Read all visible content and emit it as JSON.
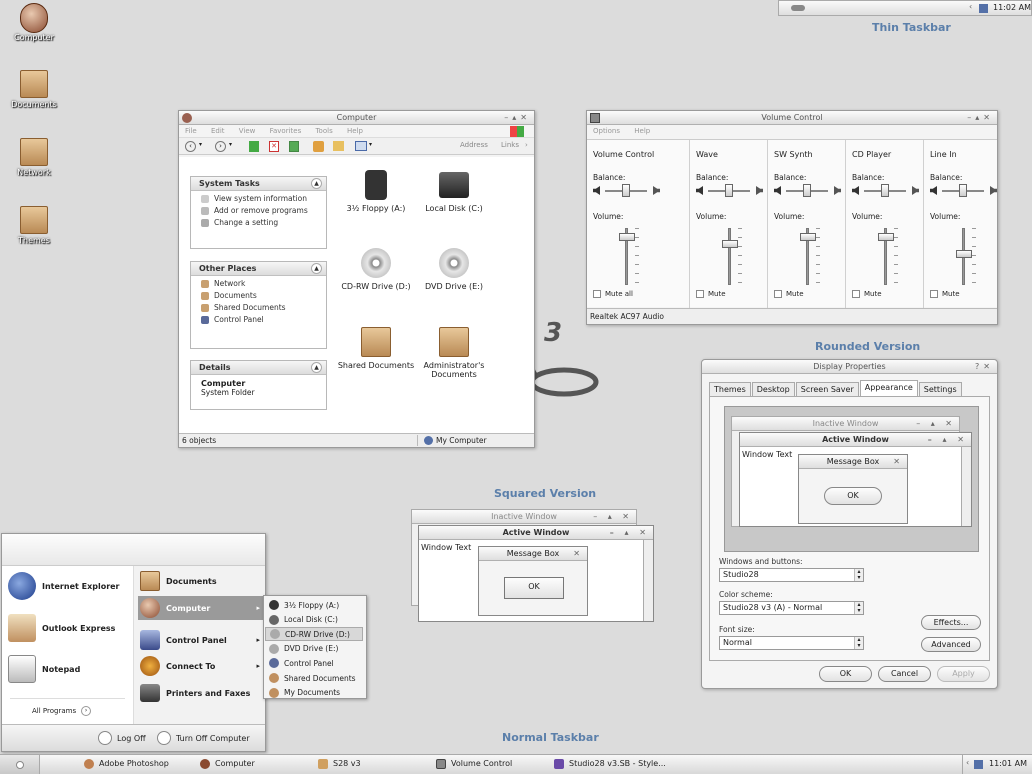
{
  "desktop": {
    "icons": [
      {
        "label": "Computer",
        "icon": "computer-icon"
      },
      {
        "label": "Documents",
        "icon": "documents-folder-icon"
      },
      {
        "label": "Network",
        "icon": "network-folder-icon"
      },
      {
        "label": "Themes",
        "icon": "themes-folder-icon"
      }
    ]
  },
  "captions": {
    "thin_taskbar": "Thin Taskbar",
    "rounded_version": "Rounded Version",
    "squared_version": "Squared Version",
    "normal_taskbar": "Normal Taskbar",
    "logo_number": "3"
  },
  "thin_taskbar": {
    "time": "11:02 AM"
  },
  "explorer": {
    "title": "Computer",
    "menu": [
      "File",
      "Edit",
      "View",
      "Favorites",
      "Tools",
      "Help"
    ],
    "address_label": "Address",
    "links_label": "Links",
    "system_tasks": {
      "title": "System Tasks",
      "items": [
        "View system information",
        "Add or remove programs",
        "Change a setting"
      ]
    },
    "other_places": {
      "title": "Other Places",
      "items": [
        "Network",
        "Documents",
        "Shared Documents",
        "Control Panel"
      ]
    },
    "details": {
      "title": "Details",
      "name": "Computer",
      "type": "System Folder"
    },
    "drives": [
      {
        "label": "3½ Floppy (A:)"
      },
      {
        "label": "Local Disk (C:)"
      },
      {
        "label": "CD-RW Drive (D:)"
      },
      {
        "label": "DVD Drive (E:)"
      },
      {
        "label": "Shared Documents"
      },
      {
        "label": "Administrator's Documents"
      }
    ],
    "status_left": "6 objects",
    "status_right": "My Computer"
  },
  "volume": {
    "title": "Volume Control",
    "menu": [
      "Options",
      "Help"
    ],
    "balance_label": "Balance:",
    "volume_label": "Volume:",
    "channels": [
      {
        "name": "Volume Control",
        "mute": "Mute all",
        "level": 0.9
      },
      {
        "name": "Wave",
        "mute": "Mute",
        "level": 0.75
      },
      {
        "name": "SW Synth",
        "mute": "Mute",
        "level": 0.9
      },
      {
        "name": "CD Player",
        "mute": "Mute",
        "level": 0.9
      },
      {
        "name": "Line In",
        "mute": "Mute",
        "level": 0.55
      }
    ],
    "status": "Realtek AC97 Audio"
  },
  "display": {
    "title": "Display Properties",
    "tabs": [
      "Themes",
      "Desktop",
      "Screen Saver",
      "Appearance",
      "Settings"
    ],
    "selected_tab": "Appearance",
    "preview": {
      "inactive": "Inactive Window",
      "active": "Active Window",
      "window_text": "Window Text",
      "message_box": "Message Box",
      "ok": "OK"
    },
    "windows_buttons_label": "Windows and buttons:",
    "windows_buttons_value": "Studio28",
    "color_scheme_label": "Color scheme:",
    "color_scheme_value": "Studio28 v3  (A) - Normal",
    "font_size_label": "Font size:",
    "font_size_value": "Normal",
    "effects": "Effects...",
    "advanced": "Advanced",
    "ok": "OK",
    "cancel": "Cancel",
    "apply": "Apply"
  },
  "squared": {
    "inactive": "Inactive Window",
    "active": "Active Window",
    "window_text": "Window Text",
    "message_box": "Message Box",
    "ok": "OK"
  },
  "start_menu": {
    "left": [
      {
        "label": "Internet Explorer"
      },
      {
        "label": "Outlook Express"
      },
      {
        "label": "Notepad"
      }
    ],
    "all_programs": "All Programs",
    "right": [
      {
        "label": "Documents"
      },
      {
        "label": "Computer"
      },
      {
        "label": "Control Panel"
      },
      {
        "label": "Connect To"
      },
      {
        "label": "Printers and Faxes"
      }
    ],
    "log_off": "Log Off",
    "turn_off": "Turn Off Computer",
    "submenu": [
      "3½ Floppy (A:)",
      "Local Disk (C:)",
      "CD-RW Drive (D:)",
      "DVD Drive (E:)",
      "Control Panel",
      "Shared Documents",
      "My Documents"
    ]
  },
  "taskbar": {
    "items": [
      "Adobe Photoshop",
      "Computer",
      "S28 v3",
      "Volume Control",
      "Studio28 v3.SB - Style..."
    ],
    "time": "11:01 AM"
  }
}
